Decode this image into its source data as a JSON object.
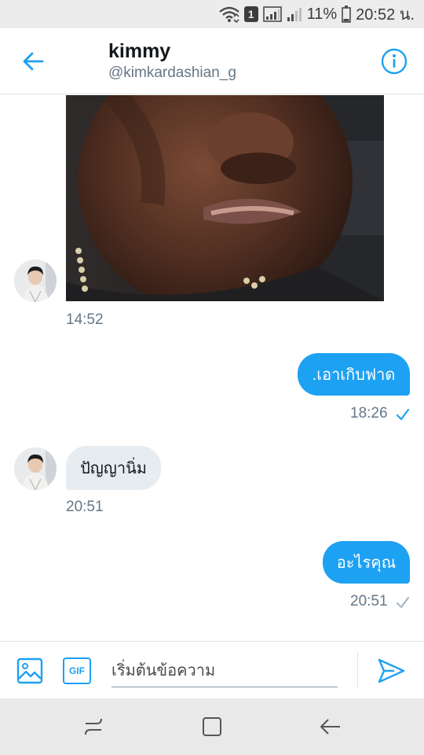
{
  "status_bar": {
    "battery_percent": "11%",
    "time": "20:52 น.",
    "sim_badge": "1",
    "icons": [
      "wifi-icon",
      "sim-1-icon",
      "signal-icon",
      "signal-icon",
      "battery-icon"
    ]
  },
  "header": {
    "title": "kimmy",
    "handle": "@kimkardashian_g",
    "back_icon": "arrow-left-icon",
    "info_icon": "info-circle-icon"
  },
  "messages": [
    {
      "direction": "incoming",
      "type": "image",
      "image": "crying-man-meme",
      "time": "14:52"
    },
    {
      "direction": "outgoing",
      "type": "text",
      "text": ".เอาเกิบฟาด",
      "time": "18:26",
      "status": "seen"
    },
    {
      "direction": "incoming",
      "type": "text",
      "text": "ปัญญานิ่ม",
      "time": "20:51"
    },
    {
      "direction": "outgoing",
      "type": "text",
      "text": "อะไรคุณ",
      "time": "20:51",
      "status": "sent"
    }
  ],
  "composer": {
    "placeholder": "เริ่มต้นข้อความ",
    "image_icon": "image-icon",
    "gif_label": "GIF",
    "send_icon": "send-icon"
  },
  "nav_bar": {
    "icons": [
      "recent-apps-icon",
      "home-icon",
      "back-icon"
    ]
  },
  "colors": {
    "accent": "#1da1f2",
    "incoming_bubble": "#e6ecf0",
    "secondary_text": "#657786"
  }
}
